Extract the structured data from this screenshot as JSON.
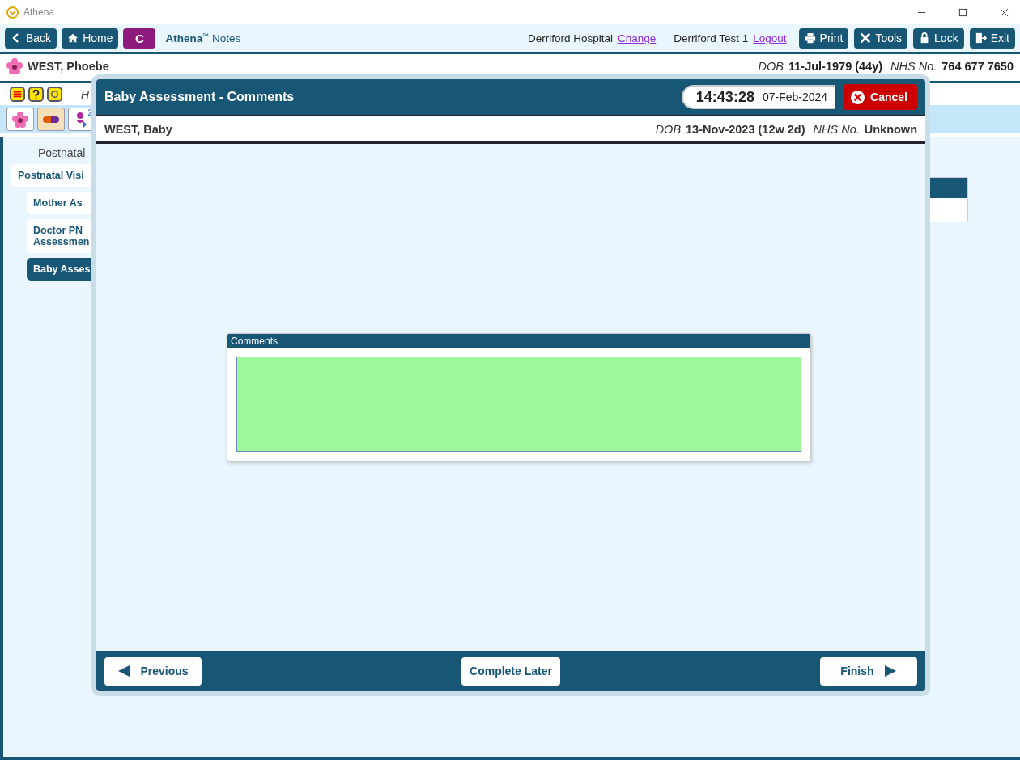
{
  "app": {
    "title": "Athena"
  },
  "toolbar": {
    "nav_buttons": [
      {
        "label": "Back"
      },
      {
        "label": "Home"
      }
    ],
    "badge": "C",
    "brand": "Athena",
    "brand_mark": "™",
    "module": "Notes",
    "hospital": "Derriford Hospital",
    "change_link": "Change",
    "user": "Derriford Test 1",
    "logout_link": "Logout",
    "actions": [
      {
        "label": "Print"
      },
      {
        "label": "Tools"
      },
      {
        "label": "Lock"
      },
      {
        "label": "Exit"
      }
    ]
  },
  "patient": {
    "name": "WEST, Phoebe",
    "dob_label": "DOB",
    "dob": "11-Jul-1979 (44y)",
    "nhs_label": "NHS No.",
    "nhs": "764 677 7650"
  },
  "alert_row": {
    "text": "H"
  },
  "quick_tabs": [
    {
      "selected": false
    },
    {
      "selected": true
    },
    {
      "count": "2",
      "selected": false
    }
  ],
  "nav": {
    "heading": "Postnatal",
    "items": [
      {
        "lines": [
          "Postnatal Visi"
        ],
        "selected": false,
        "children": [
          {
            "lines": [
              "Mother As"
            ],
            "selected": false
          },
          {
            "lines": [
              "Doctor PN",
              "Assessmen"
            ],
            "selected": false
          },
          {
            "lines": [
              "Baby Asses"
            ],
            "selected": true
          }
        ]
      }
    ]
  },
  "dialog": {
    "title": "Baby Assessment - Comments",
    "time": "14:43:28",
    "date": "07-Feb-2024",
    "cancel": "Cancel",
    "baby": {
      "name": "WEST, Baby",
      "dob_label": "DOB",
      "dob": "13-Nov-2023 (12w 2d)",
      "nhs_label": "NHS No.",
      "nhs": "Unknown"
    },
    "comments": {
      "label": "Comments"
    },
    "footer": {
      "previous": "Previous",
      "complete_later": "Complete Later",
      "finish": "Finish"
    }
  }
}
